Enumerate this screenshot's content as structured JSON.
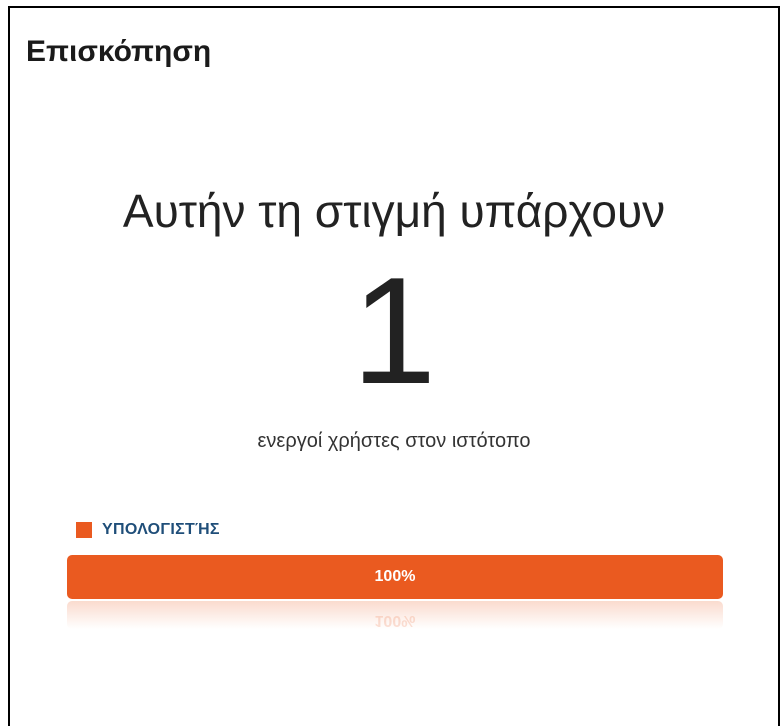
{
  "panel": {
    "title": "Επισκόπηση"
  },
  "summary": {
    "headline": "Αυτήν τη στιγμή υπάρχουν",
    "active_count": "1",
    "caption": "ενεργοί χρήστες στον ιστότοπο"
  },
  "device_breakdown": {
    "items": [
      {
        "label": "ΥΠΟΛΟΓΙΣΤΉΣ",
        "percent_label": "100%",
        "fraction": 1.0,
        "color": "#ea5a20"
      }
    ]
  }
}
